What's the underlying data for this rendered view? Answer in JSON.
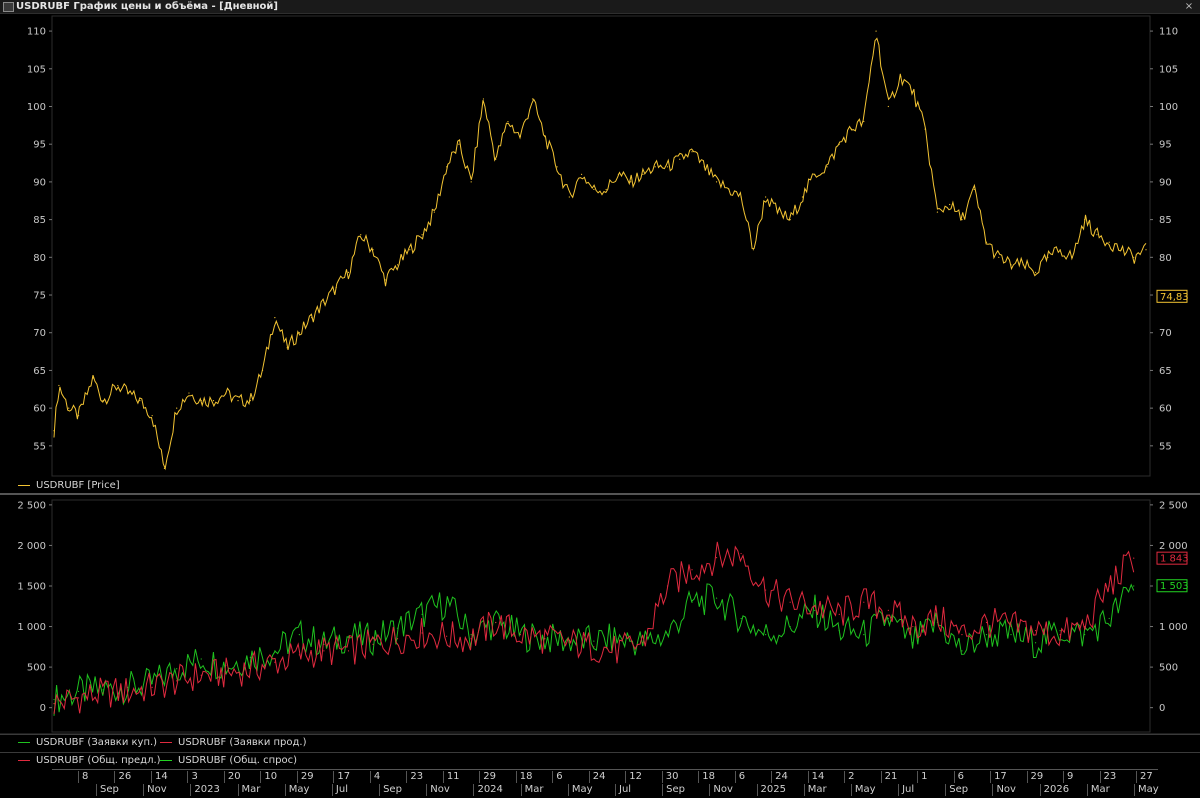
{
  "window": {
    "title": "USDRUBF График цены и объёма - [Дневной]",
    "close_glyph": "×"
  },
  "colors": {
    "price": "#f3c433",
    "bid_orders": "#1fc21f",
    "ask_orders": "#e02a3f",
    "total_offer": "#e02a3f",
    "total_demand": "#22d322",
    "grid": "#222222",
    "axis_text": "#c8c8c8"
  },
  "legends": {
    "price": "USDRUBF [Price]",
    "bid_orders": "USDRUBF (Заявки куп.)",
    "ask_orders": "USDRUBF (Заявки прод.)",
    "total_offer": "USDRUBF (Общ. предл.)",
    "total_demand": "USDRUBF (Общ. спрос)"
  },
  "time_axis": {
    "top_row": [
      "8",
      "26",
      "14",
      "3",
      "20",
      "10",
      "29",
      "17",
      "4",
      "23",
      "11",
      "29",
      "18",
      "6",
      "24",
      "12",
      "30",
      "18",
      "6",
      "24",
      "14",
      "2",
      "21",
      "1",
      "6",
      "17",
      "29",
      "9",
      "23",
      "27"
    ],
    "bottom_row": [
      "Sep",
      "Nov",
      "2023",
      "Mar",
      "May",
      "Jul",
      "Sep",
      "Nov",
      "2024",
      "Mar",
      "May",
      "Jul",
      "Sep",
      "Nov",
      "2025",
      "Mar",
      "May",
      "Jul",
      "Sep",
      "Nov",
      "2026",
      "Mar",
      "May"
    ]
  },
  "chart_data": [
    {
      "type": "line",
      "series": [
        {
          "name": "USDRUBF [Price]",
          "x": [
            0,
            0.2,
            0.6,
            1,
            1.6,
            2,
            2.6,
            3,
            3.5,
            4,
            4.5,
            5,
            5.5,
            6,
            6.5,
            7,
            7.5,
            8,
            8.5,
            9,
            9.5,
            10,
            10.5,
            11,
            11.5,
            12,
            12.5,
            13,
            13.5,
            14,
            14.5,
            15,
            15.5,
            16,
            16.5,
            17,
            17.5,
            18,
            18.5,
            19,
            19.5,
            20,
            20.5,
            21,
            21.5,
            22,
            22.5,
            23,
            23.5,
            24,
            24.5,
            25,
            25.5,
            26,
            26.5,
            27,
            27.5,
            28,
            28.5,
            29,
            29.5,
            30,
            30.5,
            31,
            31.5,
            32,
            32.5,
            33,
            33.5,
            34,
            34.5,
            35,
            35.5,
            36,
            36.5,
            37,
            37.5,
            38,
            38.5,
            39,
            39.5,
            40,
            40.5,
            41,
            41.5,
            42,
            42.5,
            43,
            43.5,
            44,
            44.5
          ],
          "values": [
            57,
            63,
            60,
            59,
            64,
            61,
            63,
            62,
            61,
            59,
            52,
            60,
            62,
            61,
            61,
            62,
            61,
            61,
            65,
            72,
            68,
            70,
            72,
            74,
            76,
            78,
            83,
            81,
            77,
            79,
            81,
            83,
            86,
            92,
            95,
            90,
            101,
            93,
            98,
            96,
            101,
            96,
            92,
            88,
            91,
            89,
            89,
            91,
            90,
            91,
            92,
            92,
            93,
            94,
            92,
            90,
            89,
            88,
            81,
            88,
            86,
            85,
            88,
            91,
            92,
            95,
            97,
            98,
            110,
            100,
            104,
            102,
            97,
            86,
            87,
            85,
            89,
            82,
            80,
            79,
            79,
            78,
            80,
            81,
            80,
            85,
            83,
            82,
            81,
            80,
            81
          ]
        }
      ],
      "ylim": [
        51,
        112
      ],
      "y_ticks": [
        55,
        60,
        65,
        70,
        75,
        80,
        85,
        90,
        95,
        100,
        105,
        110
      ],
      "last_value_label": "74,83"
    },
    {
      "type": "line",
      "series": [
        {
          "name": "USDRUBF (Заявки куп.)",
          "x": [
            0,
            1,
            2,
            3,
            4,
            5,
            6,
            7,
            8,
            9,
            10,
            11,
            12,
            13,
            14,
            15,
            16,
            17,
            18,
            19,
            20,
            21,
            22,
            23,
            24,
            25,
            26,
            27,
            28,
            29,
            30,
            31,
            32,
            33,
            34,
            35,
            36,
            37,
            38,
            39,
            40,
            41,
            42,
            43,
            44
          ],
          "values": [
            100,
            200,
            220,
            250,
            300,
            480,
            600,
            520,
            620,
            700,
            900,
            780,
            880,
            850,
            980,
            1150,
            1300,
            900,
            1050,
            900,
            850,
            830,
            820,
            850,
            800,
            900,
            1300,
            1350,
            1100,
            900,
            1000,
            1200,
            950,
            900,
            1100,
            800,
            1050,
            700,
            900,
            900,
            800,
            950,
            900,
            1100,
            1500
          ]
        },
        {
          "name": "USDRUBF (Заявки прод.)",
          "x": [
            0,
            1,
            2,
            3,
            4,
            5,
            6,
            7,
            8,
            9,
            10,
            11,
            12,
            13,
            14,
            15,
            16,
            17,
            18,
            19,
            20,
            21,
            22,
            23,
            24,
            25,
            26,
            27,
            28,
            29,
            30,
            31,
            32,
            33,
            34,
            35,
            36,
            37,
            38,
            39,
            40,
            41,
            42,
            43,
            44
          ],
          "values": [
            50,
            120,
            180,
            200,
            250,
            330,
            400,
            420,
            480,
            560,
            650,
            700,
            700,
            780,
            850,
            920,
            880,
            850,
            1050,
            900,
            850,
            800,
            750,
            700,
            800,
            1500,
            1700,
            1850,
            1900,
            1450,
            1300,
            1250,
            1150,
            1300,
            1200,
            1000,
            1100,
            900,
            1050,
            1000,
            950,
            900,
            1000,
            1500,
            1843
          ]
        }
      ],
      "ylim": [
        -300,
        2560
      ],
      "y_ticks": [
        0,
        500,
        1000,
        1500,
        2000,
        2500
      ],
      "y_tick_labels": [
        "0",
        "500",
        "1 000",
        "1 500",
        "2 000",
        "2 500"
      ],
      "last_value_labels": {
        "total_offer": "1 843",
        "total_demand": "1 503"
      }
    }
  ]
}
